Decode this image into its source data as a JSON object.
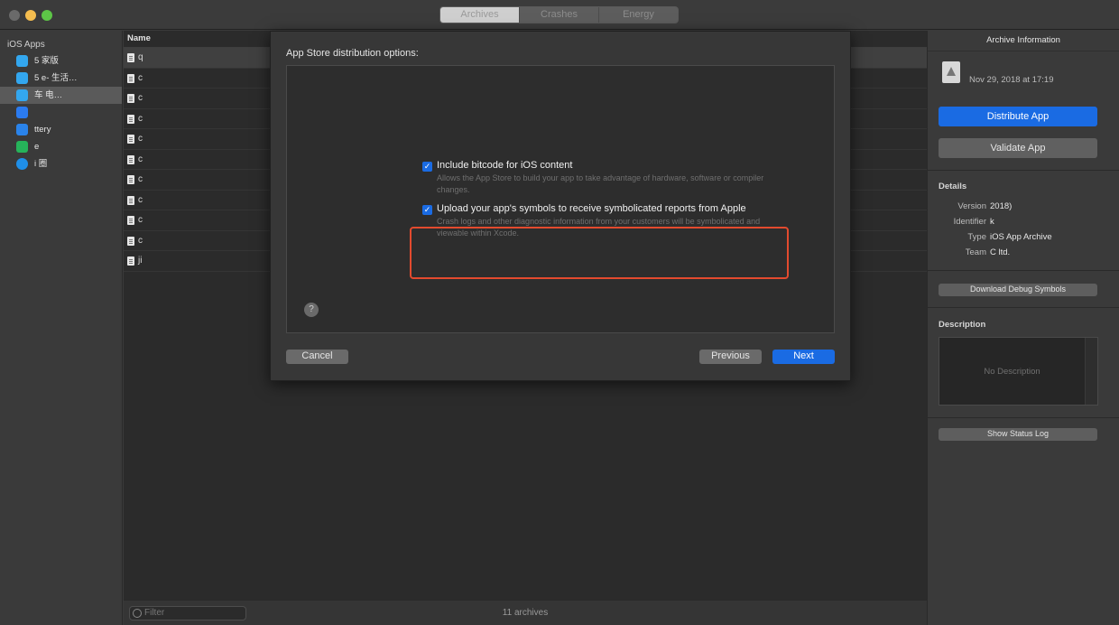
{
  "window": {
    "tabs": [
      {
        "label": "Archives"
      },
      {
        "label": "Crashes"
      },
      {
        "label": "Energy"
      }
    ]
  },
  "sidebar": {
    "heading": "iOS Apps",
    "items": [
      {
        "label": "5  家版",
        "icon_color": "#33a7ef"
      },
      {
        "label": "5  e- 生活…",
        "icon_color": "#33a7ef"
      },
      {
        "label": "  车 电…",
        "icon_color": "#33a7ef"
      },
      {
        "label": "",
        "icon_color": "#2b7bf0"
      },
      {
        "label": "  ttery",
        "icon_color": "#2a83ea"
      },
      {
        "label": "  e",
        "icon_color": "#26b35a"
      },
      {
        "label": "  i 圈",
        "icon_color": "#1f8fe8"
      }
    ]
  },
  "archive_list": {
    "column_name": "Name",
    "rows": [
      {
        "name": "q"
      },
      {
        "name": "c"
      },
      {
        "name": "c"
      },
      {
        "name": "c"
      },
      {
        "name": "c"
      },
      {
        "name": "c"
      },
      {
        "name": "c"
      },
      {
        "name": "c"
      },
      {
        "name": "c"
      },
      {
        "name": "c"
      },
      {
        "name": "ji"
      }
    ],
    "filter_placeholder": "Filter",
    "count_text": "11 archives"
  },
  "inspector": {
    "title": "Archive Information",
    "archive_name": "",
    "archive_date": "Nov 29, 2018 at 17:19",
    "distribute_label": "Distribute App",
    "validate_label": "Validate App",
    "details_title": "Details",
    "details": [
      {
        "label": "Version",
        "value": "2018)"
      },
      {
        "label": "Identifier",
        "value": "k"
      },
      {
        "label": "Type",
        "value": "iOS App Archive"
      },
      {
        "label": "Team",
        "value": "C ltd."
      }
    ],
    "download_symbols_label": "Download Debug Symbols",
    "description_title": "Description",
    "description_placeholder": "No Description",
    "show_status_log_label": "Show Status Log"
  },
  "sheet": {
    "title": "App Store distribution options:",
    "options": [
      {
        "label": "Include bitcode for iOS content",
        "description": "Allows the App Store to build your app to take advantage of hardware, software or compiler changes.",
        "checked": true
      },
      {
        "label": "Upload your app's symbols to receive symbolicated reports from Apple",
        "description": "Crash logs and other diagnostic information from your customers will be symbolicated and viewable within Xcode.",
        "checked": true
      }
    ],
    "help_label": "?",
    "cancel_label": "Cancel",
    "previous_label": "Previous",
    "next_label": "Next"
  },
  "colors": {
    "accent": "#1a6be3",
    "highlight": "#e34a2e"
  }
}
